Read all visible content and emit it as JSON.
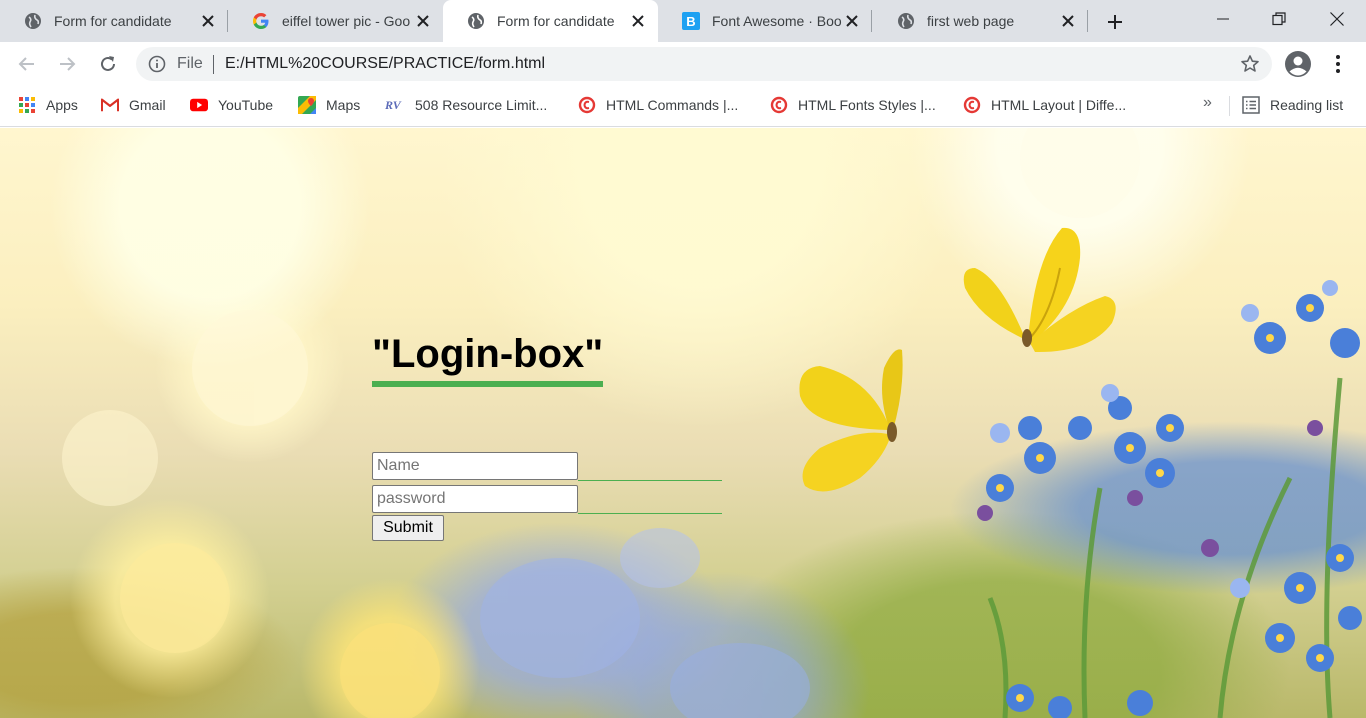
{
  "browser": {
    "tabs": [
      {
        "title": "Form for candidate",
        "icon": "globe-icon",
        "active": false
      },
      {
        "title": "eiffel tower pic - Goo",
        "icon": "google-icon",
        "active": false
      },
      {
        "title": "Form for candidate",
        "icon": "globe-icon",
        "active": true
      },
      {
        "title": "Font Awesome · Boo",
        "icon": "bootstrap-icon",
        "active": false
      },
      {
        "title": "first web page",
        "icon": "globe-icon",
        "active": false
      }
    ],
    "address_bar": {
      "scheme_label": "File",
      "url": "E:/HTML%20COURSE/PRACTICE/form.html"
    },
    "bookmarks": [
      {
        "label": "Apps",
        "icon": "apps-grid-icon"
      },
      {
        "label": "Gmail",
        "icon": "gmail-icon"
      },
      {
        "label": "YouTube",
        "icon": "youtube-icon"
      },
      {
        "label": "Maps",
        "icon": "maps-icon"
      },
      {
        "label": "508 Resource Limit...",
        "icon": "site-icon"
      },
      {
        "label": "HTML Commands |...",
        "icon": "site-c-icon"
      },
      {
        "label": "HTML Fonts Styles |...",
        "icon": "site-c-icon"
      },
      {
        "label": "HTML Layout | Diffe...",
        "icon": "site-c-icon"
      }
    ],
    "more_bookmarks": "»",
    "reading_list": "Reading list"
  },
  "page": {
    "heading": "\"Login-box\"",
    "name_placeholder": "Name",
    "password_placeholder": "password",
    "submit_label": "Submit"
  },
  "colors": {
    "accent_underline": "#4caf50",
    "tabstrip_bg": "#dee1e6"
  }
}
